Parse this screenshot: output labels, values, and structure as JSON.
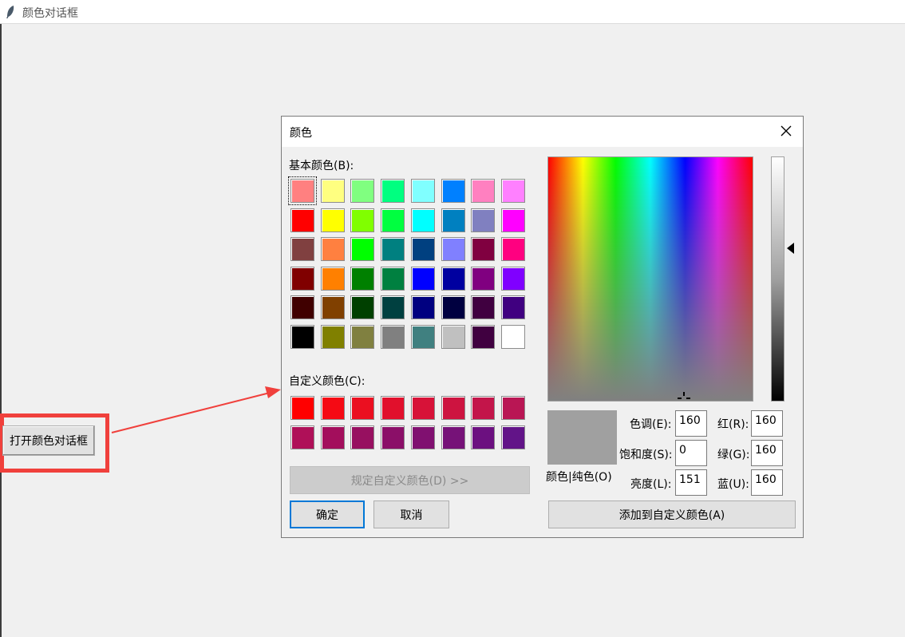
{
  "window": {
    "title": "颜色对话框"
  },
  "open_button": {
    "label": "打开颜色对话框"
  },
  "dialog": {
    "title": "颜色",
    "basic_label": "基本颜色(B):",
    "custom_label": "自定义颜色(C):",
    "define_custom_label": "规定自定义颜色(D) >>",
    "ok_label": "确定",
    "cancel_label": "取消",
    "color_solid_label": "颜色|纯色(O)",
    "hue_label": "色调(E):",
    "sat_label": "饱和度(S):",
    "lum_label": "亮度(L):",
    "red_label": "红(R):",
    "green_label": "绿(G):",
    "blue_label": "蓝(U):",
    "hue": "160",
    "sat": "0",
    "lum": "151",
    "red": "160",
    "green": "160",
    "blue": "160",
    "preview_color": "#a0a0a0",
    "add_custom_label": "添加到自定义颜色(A)",
    "basic_colors": [
      [
        "#ff8080",
        "#ffff80",
        "#80ff80",
        "#00ff80",
        "#80ffff",
        "#0080ff",
        "#ff80c0",
        "#ff80ff"
      ],
      [
        "#ff0000",
        "#ffff00",
        "#80ff00",
        "#00ff40",
        "#00ffff",
        "#0080c0",
        "#8080c0",
        "#ff00ff"
      ],
      [
        "#804040",
        "#ff8040",
        "#00ff00",
        "#008080",
        "#004080",
        "#8080ff",
        "#800040",
        "#ff0080"
      ],
      [
        "#800000",
        "#ff8000",
        "#008000",
        "#008040",
        "#0000ff",
        "#0000a0",
        "#800080",
        "#8000ff"
      ],
      [
        "#400000",
        "#804000",
        "#004000",
        "#004040",
        "#000080",
        "#000040",
        "#400040",
        "#400080"
      ],
      [
        "#000000",
        "#808000",
        "#808040",
        "#808080",
        "#408080",
        "#c0c0c0",
        "#400040",
        "#ffffff"
      ]
    ],
    "custom_colors": [
      [
        "#ff0000",
        "#f50a14",
        "#eb0f20",
        "#e1102c",
        "#d71238",
        "#cd1440",
        "#c3154a",
        "#b91654"
      ],
      [
        "#af1058",
        "#a30e5c",
        "#971060",
        "#8b0f68",
        "#801070",
        "#761278",
        "#6c1080",
        "#621488"
      ]
    ]
  },
  "accent_color": "#0078d7",
  "annotation_color": "#f0403c"
}
